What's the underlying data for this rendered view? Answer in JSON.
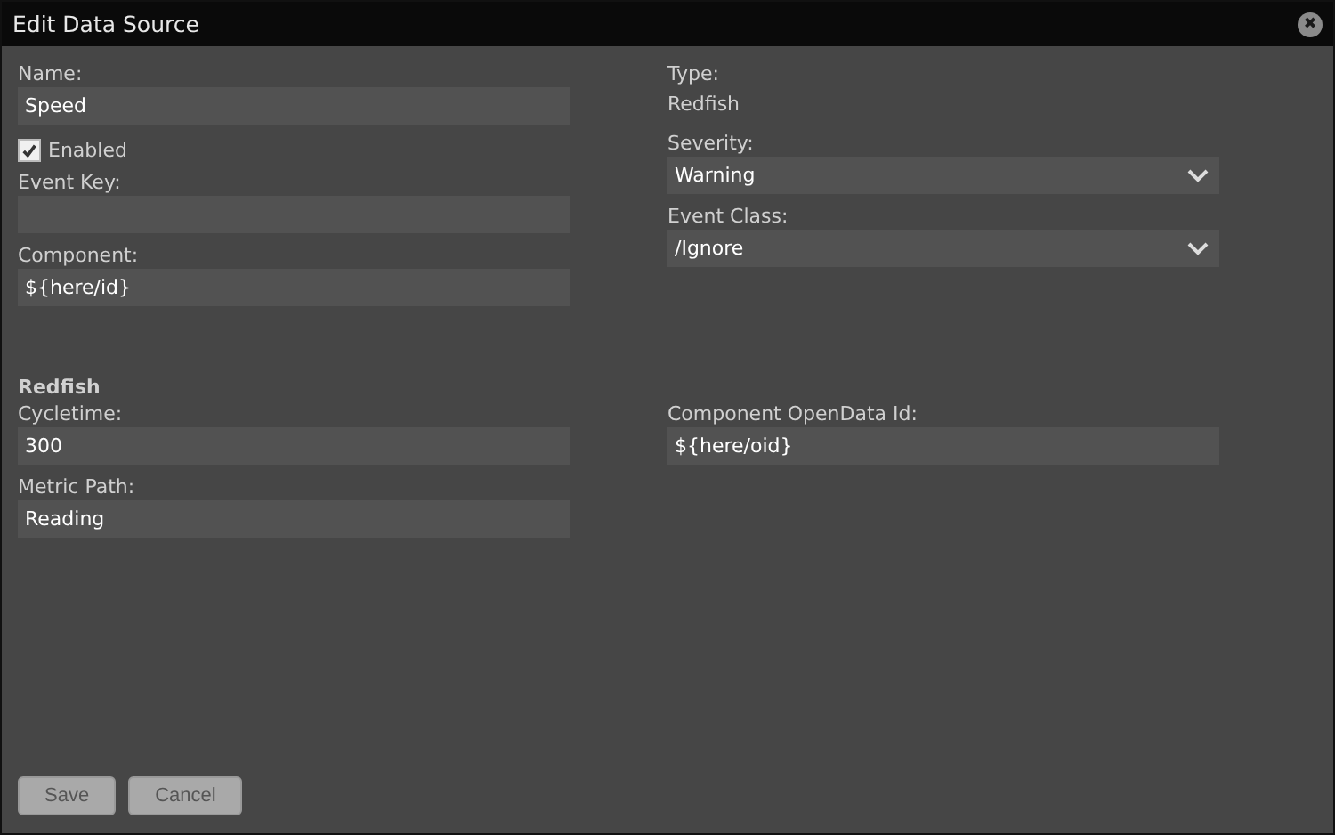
{
  "window": {
    "title": "Edit Data Source",
    "close": "✖"
  },
  "left": [
    {
      "kind": "text",
      "label": "Name:",
      "value": "Speed"
    },
    {
      "kind": "checkbox",
      "label": "Enabled",
      "checked": true
    },
    {
      "kind": "text",
      "label": "Event Key:"
    },
    {
      "kind": "text",
      "label": "Component:",
      "value": "${here/id}"
    }
  ],
  "right": [
    {
      "kind": "static",
      "label": "Type:",
      "value": "Redfish"
    },
    {
      "kind": "select",
      "label": "Severity:",
      "value": "Warning"
    },
    {
      "kind": "select",
      "label": "Event Class:",
      "value": "/Ignore"
    }
  ],
  "section": {
    "title": "Redfish",
    "left": [
      {
        "label": "Cycletime:",
        "value": "300"
      },
      {
        "label": "Metric Path:",
        "value": "Reading"
      }
    ],
    "right": [
      {
        "label": "Component OpenData Id:",
        "value": "${here/oid}"
      }
    ]
  },
  "buttons": [
    {
      "label": "Save",
      "disabled": true
    },
    {
      "label": "Cancel",
      "disabled": true
    }
  ]
}
